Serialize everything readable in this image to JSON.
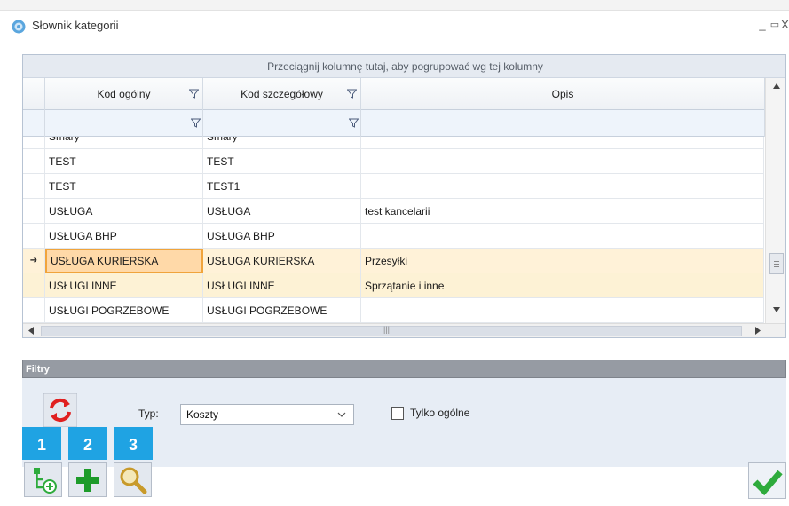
{
  "window": {
    "title": "Słownik kategorii",
    "minimize": "_",
    "maximize": "▭",
    "close": "X"
  },
  "grid": {
    "group_hint": "Przeciągnij kolumnę tutaj, aby pogrupować wg tej kolumny",
    "columns": [
      "Kod ogólny",
      "Kod szczegółowy",
      "Opis"
    ],
    "rows": [
      {
        "kod_ogolny": "Smary",
        "kod_szczegolowy": "Smary",
        "opis": ""
      },
      {
        "kod_ogolny": "TEST",
        "kod_szczegolowy": "TEST",
        "opis": ""
      },
      {
        "kod_ogolny": "TEST",
        "kod_szczegolowy": "TEST1",
        "opis": ""
      },
      {
        "kod_ogolny": "USŁUGA",
        "kod_szczegolowy": "USŁUGA",
        "opis": "test kancelarii"
      },
      {
        "kod_ogolny": "USŁUGA BHP",
        "kod_szczegolowy": "USŁUGA BHP",
        "opis": ""
      },
      {
        "kod_ogolny": "USŁUGA KURIERSKA",
        "kod_szczegolowy": "USŁUGA KURIERSKA",
        "opis": "Przesyłki"
      },
      {
        "kod_ogolny": "USŁUGI INNE",
        "kod_szczegolowy": "USŁUGI INNE",
        "opis": "Sprzątanie i inne"
      },
      {
        "kod_ogolny": "USŁUGI POGRZEBOWE",
        "kod_szczegolowy": "USŁUGI POGRZEBOWE",
        "opis": ""
      }
    ],
    "selected_row_index": 5,
    "row_indicator": "➔",
    "hscroll_grip": "|||"
  },
  "filters": {
    "header": "Filtry",
    "typ_label": "Typ:",
    "typ_value": "Koszty",
    "tylko_ogolne_label": "Tylko ogólne",
    "tylko_ogolne_checked": false
  },
  "toolbar": {
    "badges": [
      "1",
      "2",
      "3"
    ],
    "icons": [
      "add-subcategory-icon",
      "add-icon",
      "search-icon"
    ]
  },
  "colors": {
    "accent": "#1fa3e3",
    "selection": "#f0a43c",
    "ok_green": "#2eab3c",
    "add_green": "#1d9b2a",
    "reload_red": "#e02020"
  }
}
